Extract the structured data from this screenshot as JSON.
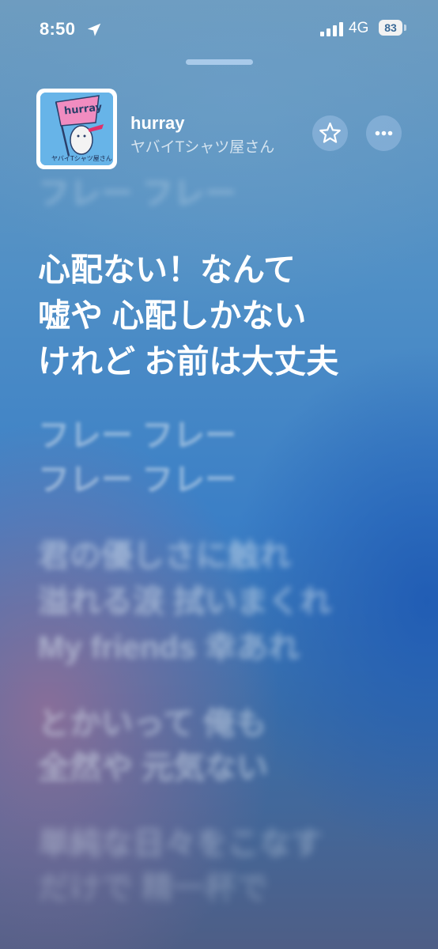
{
  "status_bar": {
    "time": "8:50",
    "network": "4G",
    "battery": "83"
  },
  "now_playing": {
    "title": "hurray",
    "artist": "ヤバイTシャツ屋さん",
    "artwork_label": "hurray"
  },
  "lyrics": {
    "previous_line": "フレー フレー",
    "active_lines": [
      "心配ない！なんて",
      "嘘や 心配しかない",
      "けれど お前は大丈夫"
    ],
    "upcoming_lines": [
      "フレー フレー",
      "フレー フレー",
      "君の優しさに触れ",
      "溢れる涙 拭いまくれ",
      "My friends  幸あれ",
      "とかいって 俺も",
      "全然や 元気ない",
      "単純な日々をこなす",
      "だけで 精一杯で"
    ]
  },
  "colors": {
    "background_top": "#6e9cbf",
    "background_mid": "#3b7fc6",
    "artwork_bg": "#67b4e8",
    "flag": "#f08cc0"
  },
  "icons": [
    "location-arrow-icon",
    "cellular-signal-icon",
    "battery-icon",
    "star-icon",
    "ellipsis-icon"
  ]
}
